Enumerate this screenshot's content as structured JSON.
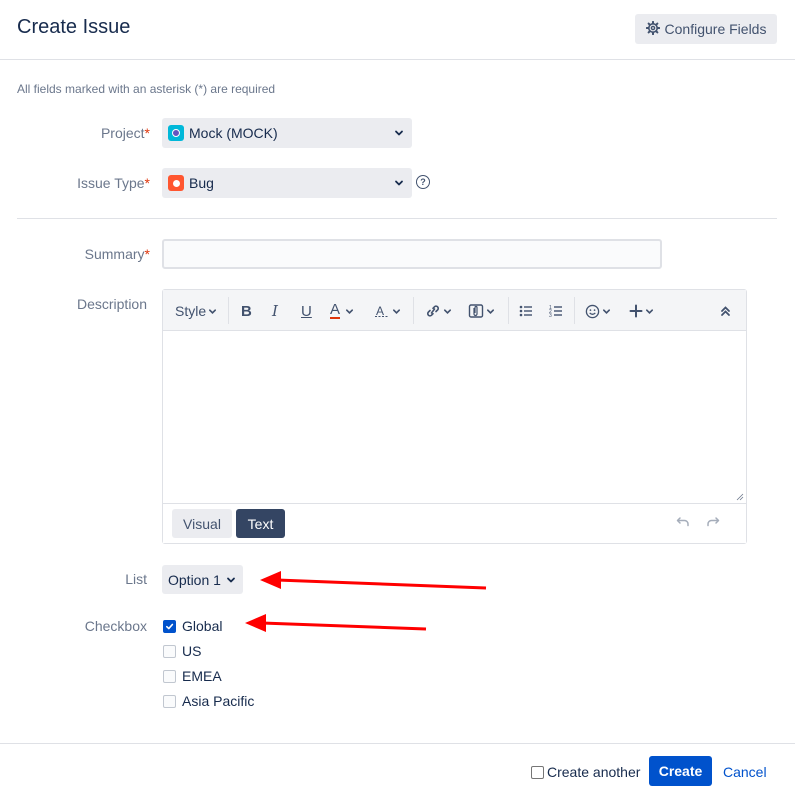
{
  "dialog": {
    "title": "Create Issue",
    "configure_fields_label": "Configure Fields",
    "required_note": "All fields marked with an asterisk (*) are required"
  },
  "fields": {
    "project": {
      "label": "Project",
      "required_mark": "*",
      "value": "Mock (MOCK)",
      "icon": "project-avatar-icon"
    },
    "issue_type": {
      "label": "Issue Type",
      "required_mark": "*",
      "value": "Bug",
      "icon": "bug-icon"
    },
    "summary": {
      "label": "Summary",
      "required_mark": "*",
      "value": "",
      "placeholder": ""
    },
    "description": {
      "label": "Description",
      "value": "",
      "toolbar": {
        "style_label": "Style",
        "buttons": [
          "bold",
          "italic",
          "underline",
          "text-color",
          "more-formatting",
          "link",
          "attachment",
          "bullet-list",
          "numbered-list",
          "emoji",
          "insert-more",
          "collapse"
        ]
      },
      "modes": {
        "visual_label": "Visual",
        "text_label": "Text",
        "active": "Text"
      }
    },
    "list": {
      "label": "List",
      "value": "Option 1"
    },
    "checkbox": {
      "label": "Checkbox",
      "options": [
        {
          "label": "Global",
          "checked": true
        },
        {
          "label": "US",
          "checked": false
        },
        {
          "label": "EMEA",
          "checked": false
        },
        {
          "label": "Asia Pacific",
          "checked": false
        }
      ]
    }
  },
  "footer": {
    "create_another_label": "Create another",
    "create_another_checked": false,
    "create_label": "Create",
    "cancel_label": "Cancel"
  },
  "colors": {
    "primary": "#0052cc",
    "required": "#de350b",
    "annotation_arrow": "#ff0000"
  }
}
